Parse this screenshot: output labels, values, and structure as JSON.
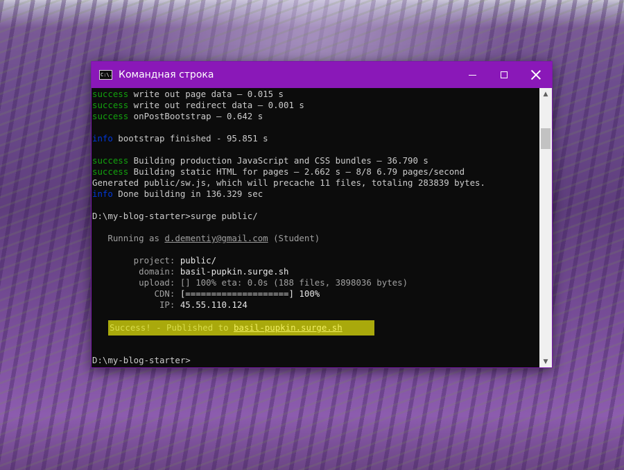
{
  "window": {
    "title": "Командная строка",
    "icon_text": "C:\\."
  },
  "console": {
    "l1": {
      "tag": "success",
      "text": " write out page data — 0.015 s"
    },
    "l2": {
      "tag": "success",
      "text": " write out redirect data — 0.001 s"
    },
    "l3": {
      "tag": "success",
      "text": " onPostBootstrap — 0.642 s"
    },
    "l4": {
      "tag": "info",
      "text": " bootstrap finished - 95.851 s"
    },
    "l5": {
      "tag": "success",
      "text": " Building production JavaScript and CSS bundles — 36.790 s"
    },
    "l6": {
      "tag": "success",
      "text": " Building static HTML for pages — 2.662 s — 8/8 6.79 pages/second"
    },
    "l7": {
      "text": "Generated public/sw.js, which will precache 11 files, totaling 283839 bytes."
    },
    "l8": {
      "tag": "info",
      "text": " Done building in 136.329 sec"
    },
    "l9": {
      "text": "D:\\my-blog-starter>surge public/"
    },
    "l10": {
      "prefix": "   Running as ",
      "email": "d.dementiy@gmail.com",
      "suffix": " (Student)"
    },
    "l11": {
      "label": "        project: ",
      "value": "public/"
    },
    "l12": {
      "label": "         domain: ",
      "value": "basil-pupkin.surge.sh"
    },
    "l13": {
      "label": "         upload: ",
      "value": "[] 100% eta: 0.0s (188 files, 3898036 bytes)"
    },
    "l14": {
      "label": "            CDN: ",
      "value": "[====================] 100%"
    },
    "l15": {
      "label": "             IP: ",
      "value": "45.55.110.124"
    },
    "l16": {
      "prefix": "Success! - Published to ",
      "link": "basil-pupkin.surge.sh"
    },
    "l17": {
      "text": "D:\\my-blog-starter>"
    }
  },
  "colors": {
    "titlebar": "#8a18b8",
    "success": "#13a10e",
    "info": "#0037da",
    "highlight": "#a9a90c"
  },
  "icons": {
    "minimize": "minimize-icon",
    "maximize": "maximize-icon",
    "close": "close-icon",
    "scroll_up": "chevron-up-icon",
    "scroll_down": "chevron-down-icon"
  }
}
